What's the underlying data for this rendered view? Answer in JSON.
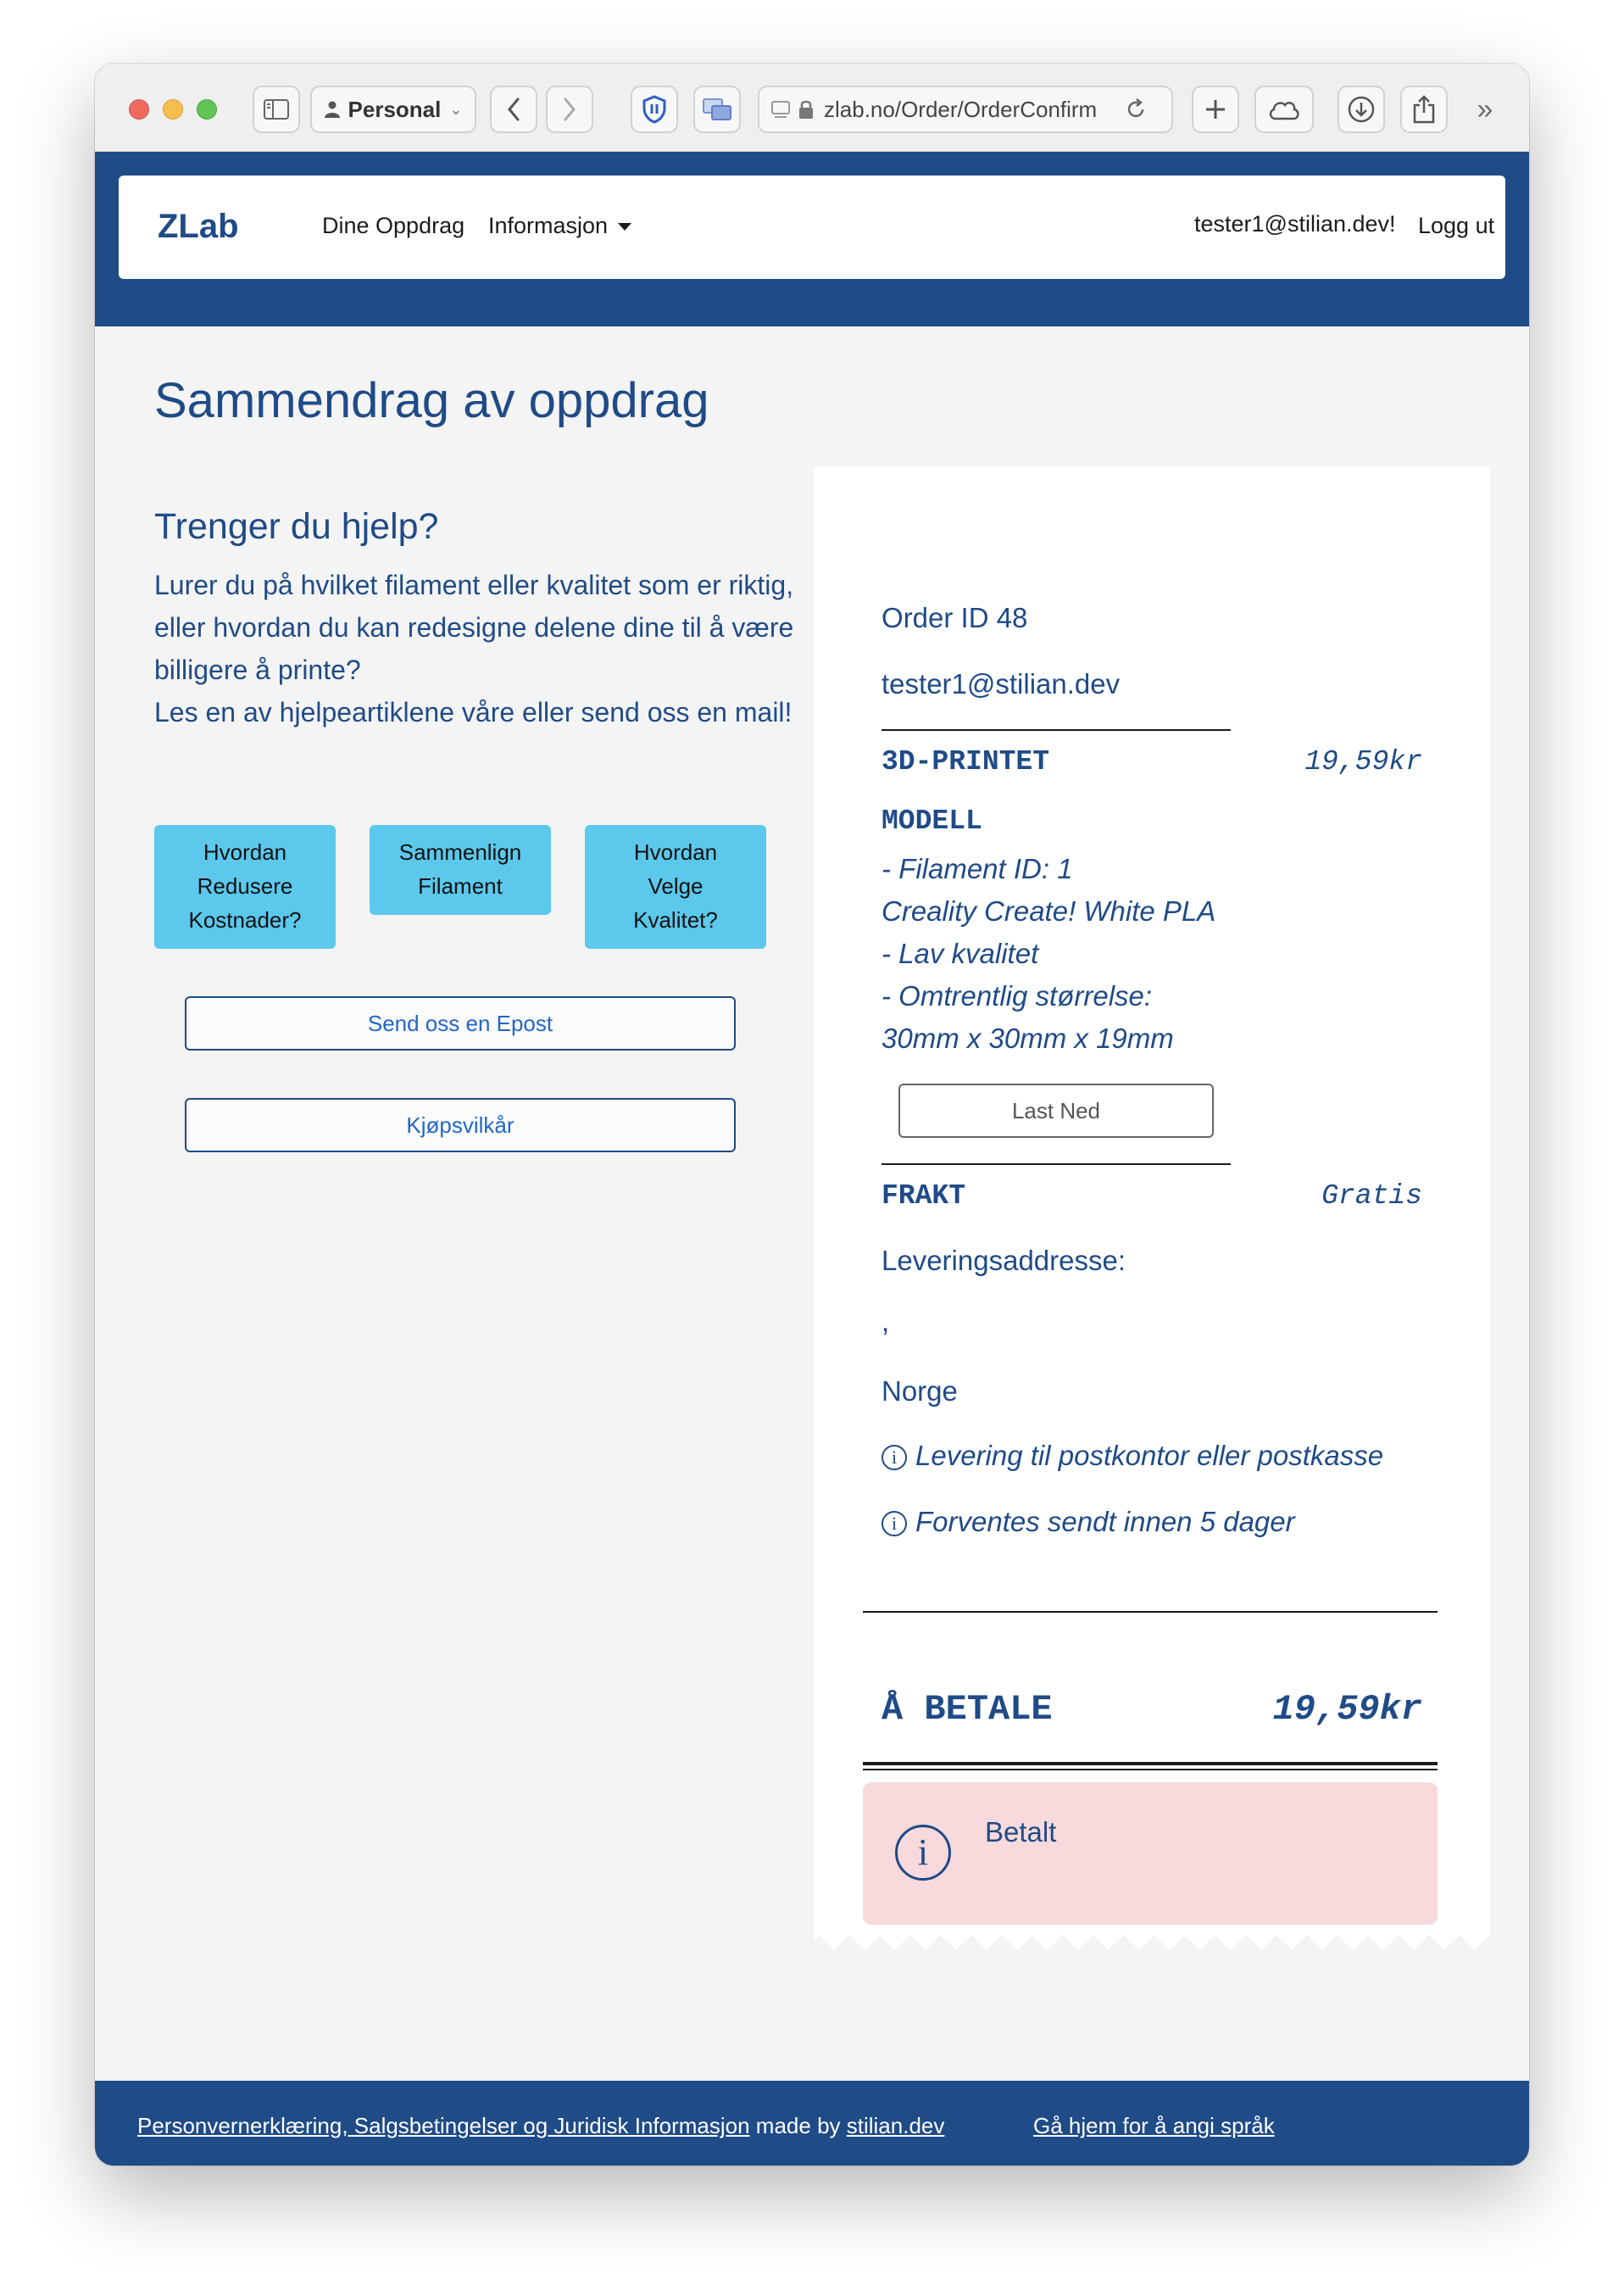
{
  "browser": {
    "profile_label": "Personal",
    "url": "zlab.no/Order/OrderConfirm"
  },
  "nav": {
    "brand": "ZLab",
    "items": [
      {
        "label": "Dine Oppdrag"
      },
      {
        "label": "Informasjon"
      }
    ],
    "user_label": "tester1@stilian.dev!",
    "logout_label": "Logg ut"
  },
  "page": {
    "title": "Sammendrag av oppdrag"
  },
  "help": {
    "title": "Trenger du hjelp?",
    "text_line1": "Lurer du på hvilket filament eller kvalitet som er riktig, eller hvordan du kan redesigne delene dine til å være billigere å printe?",
    "text_line2": "Les en av hjelpeartiklene våre eller send oss en mail!",
    "buttons": [
      {
        "label": "Hvordan Redusere Kostnader?"
      },
      {
        "label": "Sammenlign Filament"
      },
      {
        "label": "Hvordan Velge Kvalitet?"
      }
    ],
    "email_button": "Send oss en Epost",
    "terms_button": "Kjøpsvilkår"
  },
  "receipt": {
    "order_id": "Order ID 48",
    "email": "tester1@stilian.dev",
    "printed_label": "3D-PRINTET",
    "printed_price": "19,59kr",
    "model_label": "MODELL",
    "model_details": [
      "- Filament ID: 1",
      "Creality Create! White PLA",
      "- Lav kvalitet",
      "- Omtrentlig størrelse:",
      "30mm x 30mm x 19mm"
    ],
    "download_button": "Last Ned",
    "shipping_label": "FRAKT",
    "shipping_price": "Gratis",
    "address_label": "Leveringsaddresse:",
    "address_line": ",",
    "country": "Norge",
    "info_delivery": "Levering til postkontor eller postkasse",
    "info_sent": "Forventes sendt innen 5 dager",
    "total_label": "Å BETALE",
    "total_price": "19,59kr",
    "status": "Betalt"
  },
  "footer": {
    "legal_link": "Personvernerklæring, Salgsbetingelser og Juridisk Informasjon",
    "made_by": " made by ",
    "author_link": "stilian.dev",
    "home_link": "Gå hjem for å angi språk"
  },
  "colors": {
    "brand_blue": "#1f4b87",
    "help_button": "#5bc8ec",
    "alert_bg": "#f8dadc",
    "link_blue": "#2267c9"
  }
}
